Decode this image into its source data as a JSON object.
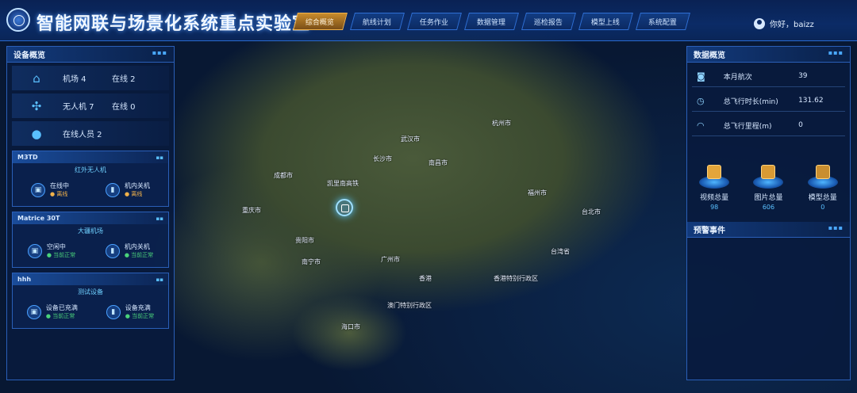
{
  "header": {
    "title": "智能网联与场景化系统重点实验室",
    "tabs": [
      "综合概览",
      "航线计划",
      "任务作业",
      "数据管理",
      "巡检报告",
      "模型上线",
      "系统配置"
    ],
    "active_tab": 0,
    "user": "你好，baizz"
  },
  "map": {
    "labels": [
      "成都市",
      "重庆市",
      "贵阳市",
      "长沙市",
      "南昌市",
      "福州市",
      "台北市",
      "广州市",
      "南宁市",
      "香港",
      "香港特别行政区",
      "澳门特别行政区",
      "海口市",
      "台湾省",
      "武汉市",
      "杭州市"
    ],
    "marker_label": "凯里南高铁"
  },
  "left_panel": {
    "title": "设备概览",
    "overview": [
      {
        "icon": "dock-icon",
        "a": "机场 4",
        "b": "在线 2"
      },
      {
        "icon": "drone-icon",
        "a": "无人机 7",
        "b": "在线 0"
      },
      {
        "icon": "person-icon",
        "a": "在线人员 2",
        "b": ""
      }
    ],
    "devices": [
      {
        "name": "M3TD",
        "sub": "红外无人机",
        "items": [
          {
            "text": "在线中",
            "note": "● 离线",
            "green": false
          },
          {
            "text": "机内关机",
            "note": "● 离线",
            "green": false
          }
        ]
      },
      {
        "name": "Matrice 30T",
        "sub": "大疆机场",
        "items": [
          {
            "text": "空闲中",
            "note": "● 当前正常",
            "green": true
          },
          {
            "text": "机内关机",
            "note": "● 当前正常",
            "green": true
          }
        ]
      },
      {
        "name": "hhh",
        "sub": "测试设备",
        "items": [
          {
            "text": "设备已充满",
            "note": "● 当前正常",
            "green": true
          },
          {
            "text": "设备充满",
            "note": "● 当前正常",
            "green": true
          }
        ]
      }
    ]
  },
  "right_panel": {
    "title": "数据概览",
    "stats": [
      {
        "icon": "camera-icon",
        "label": "本月航次",
        "value": "39"
      },
      {
        "icon": "clock-icon",
        "label": "总飞行时长(min)",
        "value": "131.62"
      },
      {
        "icon": "distance-icon",
        "label": "总飞行里程(m)",
        "value": "0"
      }
    ],
    "media": [
      {
        "label": "视频总量",
        "count": "98"
      },
      {
        "label": "图片总量",
        "count": "606"
      },
      {
        "label": "模型总量",
        "count": "0"
      }
    ],
    "events_title": "预警事件"
  }
}
